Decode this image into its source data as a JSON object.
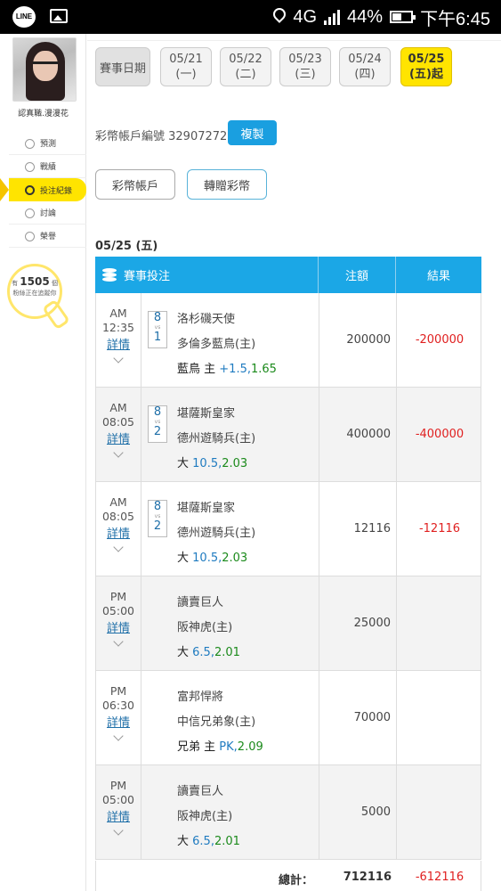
{
  "statusbar": {
    "line_label": "LINE",
    "network": "4G",
    "battery": "44%",
    "time": "下午6:45"
  },
  "sidebar": {
    "username": "認真職.漫漫花",
    "nav": [
      {
        "label": "預測",
        "icon": "target-icon"
      },
      {
        "label": "戰績",
        "icon": "chat-icon"
      },
      {
        "label": "投注紀錄",
        "icon": "record-icon",
        "active": true
      },
      {
        "label": "討論",
        "icon": "discussion-icon"
      },
      {
        "label": "榮譽",
        "icon": "medal-icon"
      }
    ],
    "fans_prefix": "有",
    "fans_count": "1505",
    "fans_suffix": "個",
    "fans_text": "粉絲正在追蹤你"
  },
  "main": {
    "date_label": "賽事日期",
    "dates": [
      {
        "date": "05/21",
        "weekday": "(一)"
      },
      {
        "date": "05/22",
        "weekday": "(二)"
      },
      {
        "date": "05/23",
        "weekday": "(三)"
      },
      {
        "date": "05/24",
        "weekday": "(四)"
      },
      {
        "date": "05/25",
        "weekday": "(五)",
        "suffix": "起",
        "selected": true
      }
    ],
    "account_label": "彩幣帳戶編號 32907272",
    "copy_label": "複製",
    "tab1": "彩幣帳戶",
    "tab2": "轉贈彩幣",
    "section_date": "05/25 (五)",
    "table": {
      "col1": "賽事投注",
      "col2": "注額",
      "col3": "結果",
      "detail_label": "詳情",
      "rows": [
        {
          "ampm": "AM",
          "time": "12:35",
          "vs_top": "8",
          "vs_mid": "vs",
          "vs_bot": "1",
          "team1": "洛杉磯天使",
          "team2": "多倫多藍鳥(主)",
          "bet_key": "藍鳥 主",
          "bet_hc": "+1.5",
          "bet_od": "1.65",
          "amount": "200000",
          "result": "-200000"
        },
        {
          "ampm": "AM",
          "time": "08:05",
          "vs_top": "8",
          "vs_mid": "vs",
          "vs_bot": "2",
          "team1": "堪薩斯皇家",
          "team2": "德州遊騎兵(主)",
          "bet_key": "大",
          "bet_hc": "10.5",
          "bet_od": "2.03",
          "amount": "400000",
          "result": "-400000"
        },
        {
          "ampm": "AM",
          "time": "08:05",
          "vs_top": "8",
          "vs_mid": "vs",
          "vs_bot": "2",
          "team1": "堪薩斯皇家",
          "team2": "德州遊騎兵(主)",
          "bet_key": "大",
          "bet_hc": "10.5",
          "bet_od": "2.03",
          "amount": "12116",
          "result": "-12116"
        },
        {
          "ampm": "PM",
          "time": "05:00",
          "team1": "讀賣巨人",
          "team2": "阪神虎(主)",
          "bet_key": "大",
          "bet_hc": "6.5",
          "bet_od": "2.01",
          "amount": "25000",
          "result": ""
        },
        {
          "ampm": "PM",
          "time": "06:30",
          "team1": "富邦悍將",
          "team2": "中信兄弟象(主)",
          "bet_key": "兄弟 主",
          "bet_hc": "PK",
          "bet_od": "2.09",
          "amount": "70000",
          "result": ""
        },
        {
          "ampm": "PM",
          "time": "05:00",
          "team1": "讀賣巨人",
          "team2": "阪神虎(主)",
          "bet_key": "大",
          "bet_hc": "6.5",
          "bet_od": "2.01",
          "amount": "5000",
          "result": ""
        }
      ],
      "total_label": "總計：",
      "total_amount": "712116",
      "total_result": "-612116"
    }
  }
}
